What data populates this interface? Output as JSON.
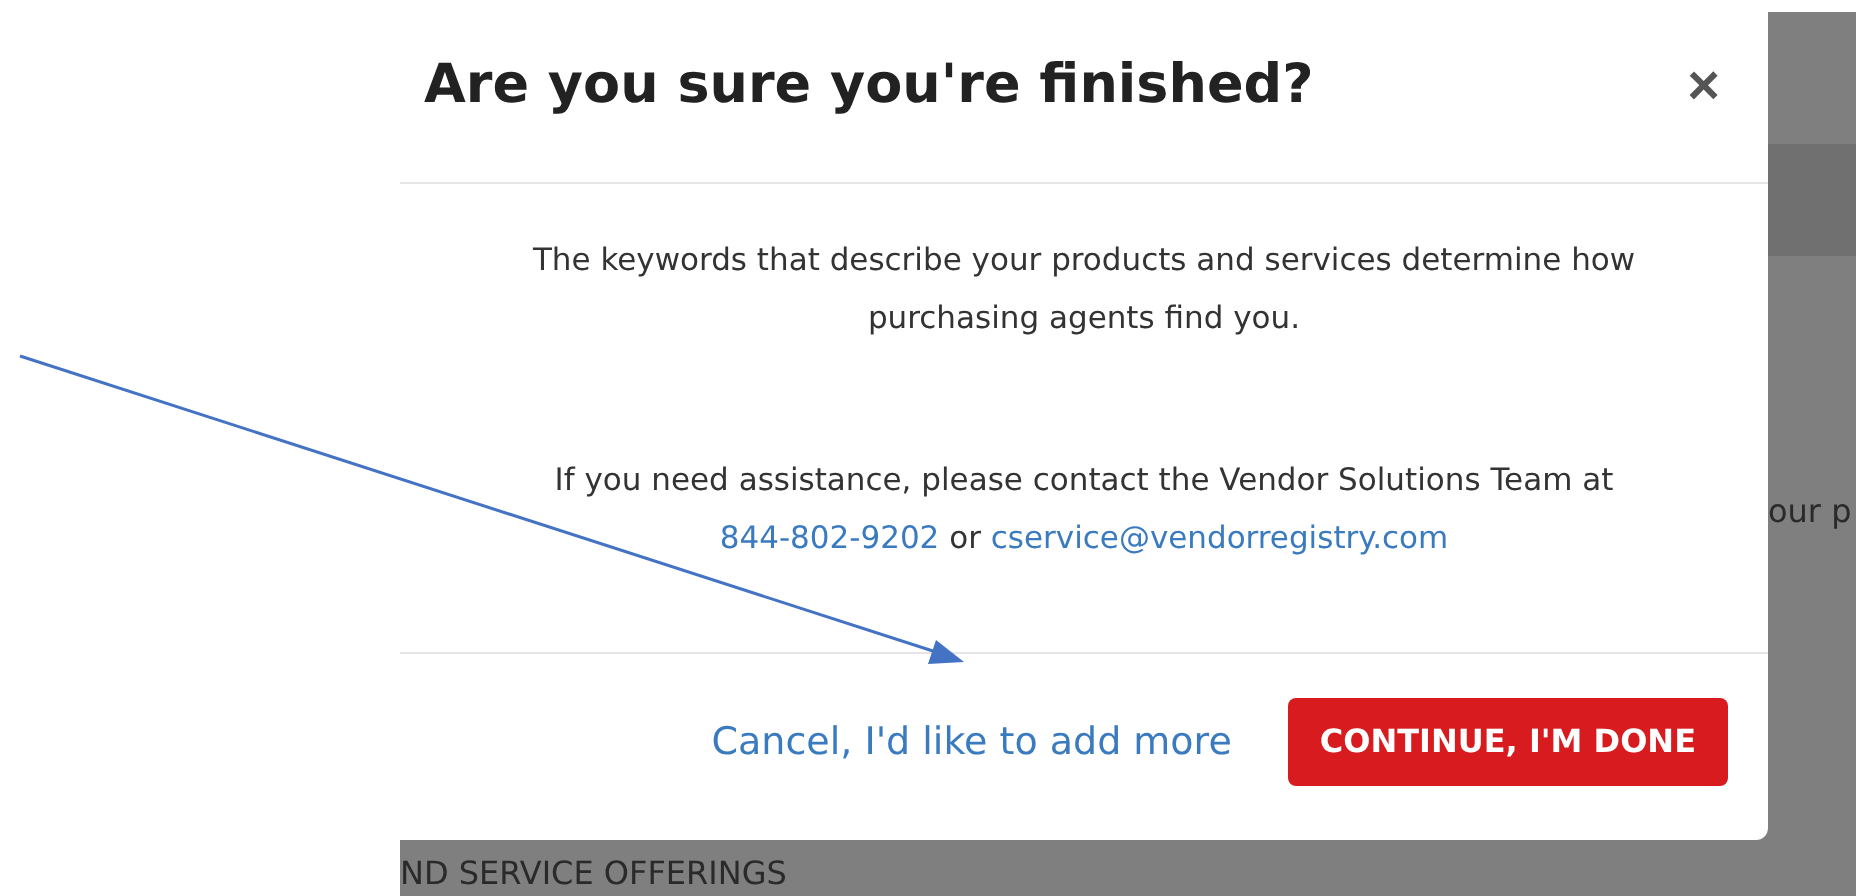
{
  "background": {
    "side_text": "our p",
    "section_heading": "ND SERVICE OFFERINGS"
  },
  "dialog": {
    "title": "Are you sure you're finished?",
    "close": "×",
    "message": "The keywords that describe your products and services determine how purchasing agents find you.",
    "assistance": "If you need assistance, please contact the Vendor Solutions Team at",
    "phone": "844-802-9202",
    "separator": "or",
    "email": "cservice@vendorregistry.com",
    "cancel": "Cancel, I'd like to add more",
    "confirm": "CONTINUE, I'M DONE"
  }
}
